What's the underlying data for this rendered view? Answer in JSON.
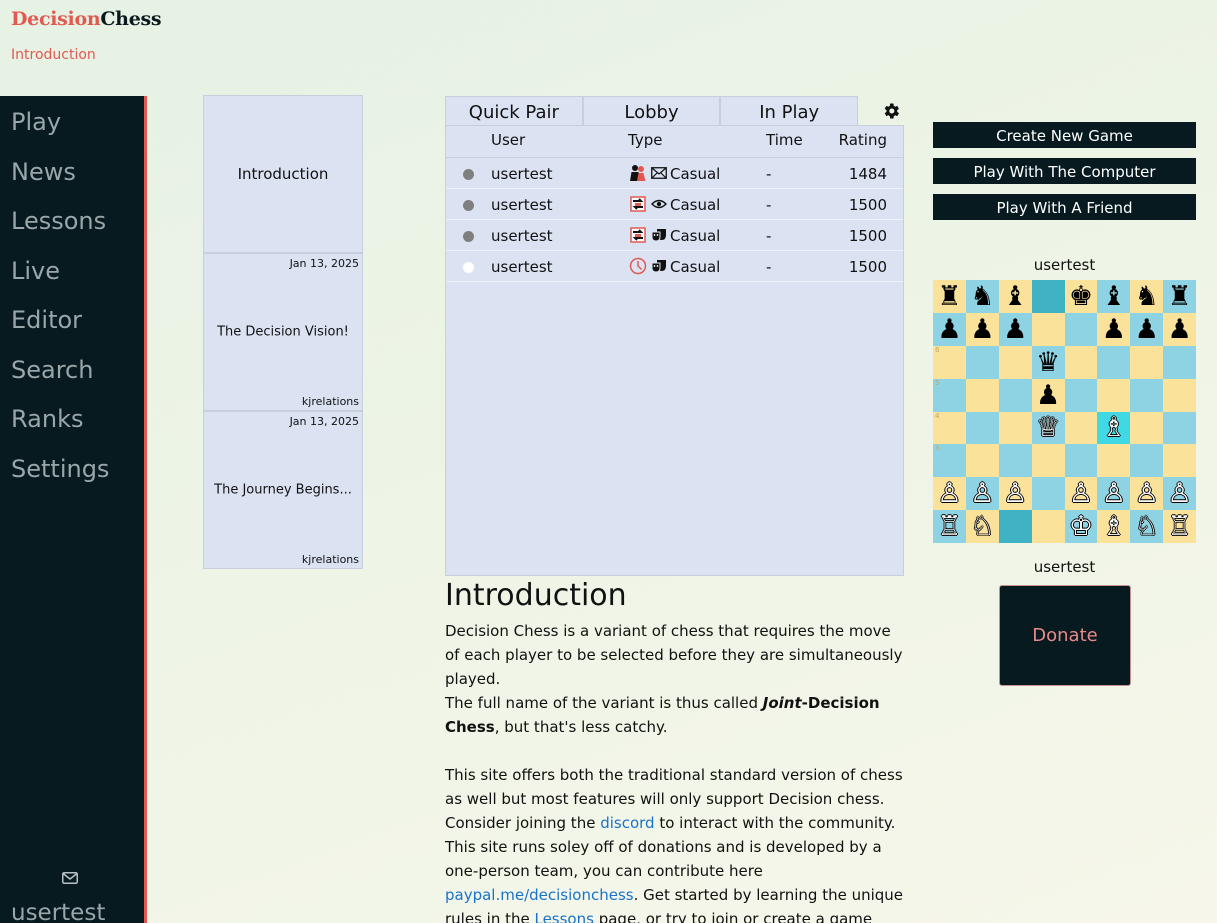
{
  "brand": {
    "part1": "Decision",
    "part2": "Chess"
  },
  "breadcrumb": "Introduction",
  "sidebar": {
    "items": [
      {
        "label": "Play"
      },
      {
        "label": "News"
      },
      {
        "label": "Lessons"
      },
      {
        "label": "Live"
      },
      {
        "label": "Editor"
      },
      {
        "label": "Search"
      },
      {
        "label": "Ranks"
      },
      {
        "label": "Settings"
      }
    ],
    "mail_icon": "envelope-icon",
    "username": "usertest"
  },
  "news": [
    {
      "title": "Introduction",
      "date": "",
      "author": ""
    },
    {
      "title": "The Decision Vision!",
      "date": "Jan 13, 2025",
      "author": "kjrelations"
    },
    {
      "title": "The Journey Begins...",
      "date": "Jan 13, 2025",
      "author": "kjrelations"
    }
  ],
  "lobby": {
    "tabs": [
      {
        "label": "Quick Pair"
      },
      {
        "label": "Lobby"
      },
      {
        "label": "In Play"
      }
    ],
    "settings_icon": "gear-icon",
    "columns": {
      "user": "User",
      "type": "Type",
      "time": "Time",
      "rating": "Rating"
    },
    "rows": [
      {
        "status": "grey",
        "user": "usertest",
        "icon1": "players-icon",
        "icon2": "envelope-icon",
        "type": "Casual",
        "time": "-",
        "rating": "1484"
      },
      {
        "status": "grey",
        "user": "usertest",
        "icon1": "swap-icon",
        "icon2": "eye-icon",
        "type": "Casual",
        "time": "-",
        "rating": "1500"
      },
      {
        "status": "grey",
        "user": "usertest",
        "icon1": "swap-icon",
        "icon2": "masks-icon",
        "type": "Casual",
        "time": "-",
        "rating": "1500"
      },
      {
        "status": "white",
        "user": "usertest",
        "icon1": "clock-icon",
        "icon2": "masks-icon",
        "type": "Casual",
        "time": "-",
        "rating": "1500"
      }
    ]
  },
  "intro": {
    "heading": "Introduction",
    "p1": "Decision Chess is a variant of chess that requires the move of each player to be selected before they are simultaneously played.",
    "p2_before": "The full name of the variant is thus called ",
    "p2_italic": "Joint",
    "p2_bold": "-Decision Chess",
    "p2_after": ", but that's less catchy.",
    "p3_a": "This site offers both the traditional standard version of chess as well but most features will only support Decision chess. Consider joining the ",
    "p3_link1": "discord",
    "p3_b": " to interact with the community. This site runs soley off of donations and is developed by a one-person team, you can contribute here ",
    "p3_link2": "paypal.me/decisionchess",
    "p3_c": ". Get started by learning the unique rules in the ",
    "p3_link3": "Lessons",
    "p3_d": " page, or try to join or create a game yourself."
  },
  "actions": {
    "create": "Create New Game",
    "computer": "Play With The Computer",
    "friend": "Play With A Friend"
  },
  "board": {
    "top_player": "usertest",
    "bottom_player": "usertest",
    "rows": [
      "rnb.kbnr",
      "ppp..ppp",
      "...q....",
      "...p....",
      "...Q.B..",
      "........",
      "PPP.PPPP",
      "RN..KBNR"
    ],
    "highlight_dark": [
      "0,3",
      "7,2"
    ],
    "highlight_light": [
      "4,5"
    ],
    "rank_labels": [
      "6",
      "5",
      "4",
      "3"
    ]
  },
  "donate": "Donate"
}
